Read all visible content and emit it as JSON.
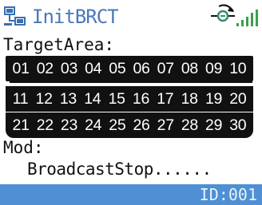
{
  "titlebar": {
    "title": "InitBRCT",
    "icons": [
      "network-icon",
      "connection-icon",
      "signal-strength-icon"
    ],
    "accent_color": "#4a79b8"
  },
  "target_area": {
    "label": "TargetArea:",
    "rows": [
      [
        "01",
        "02",
        "03",
        "04",
        "05",
        "06",
        "07",
        "08",
        "09",
        "10"
      ],
      [
        "11",
        "12",
        "13",
        "14",
        "15",
        "16",
        "17",
        "18",
        "19",
        "20"
      ],
      [
        "21",
        "22",
        "23",
        "24",
        "25",
        "26",
        "27",
        "28",
        "29",
        "30"
      ]
    ]
  },
  "mod": {
    "label": "Mod:"
  },
  "status": {
    "text": "BroadcastStop......"
  },
  "footer": {
    "id_text": "ID:001",
    "color": "#4f8fd3"
  }
}
